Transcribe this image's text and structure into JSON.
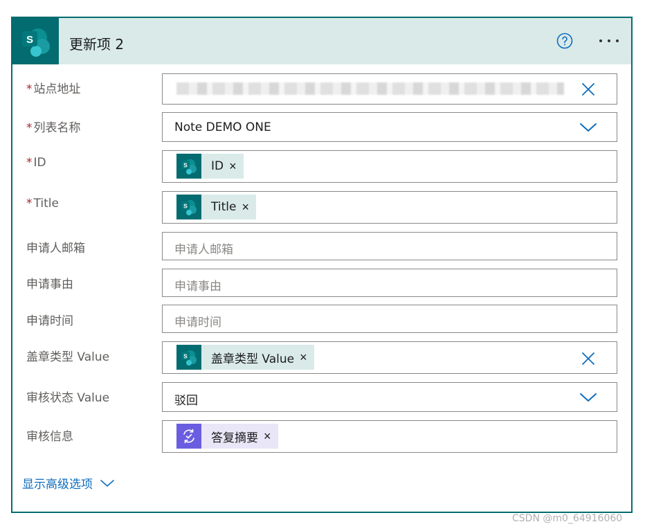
{
  "header": {
    "title": "更新项 2",
    "logo_letter": "S",
    "accent_color": "#036c70"
  },
  "fields": {
    "site": {
      "label": "站点地址",
      "required": "*"
    },
    "list": {
      "label": "列表名称",
      "required": "*",
      "value": "Note DEMO ONE"
    },
    "id": {
      "label": "ID",
      "required": "*",
      "token": "ID"
    },
    "title": {
      "label": "Title",
      "required": "*",
      "token": "Title"
    },
    "email": {
      "label": "申请人邮箱",
      "placeholder": "申请人邮箱"
    },
    "reason": {
      "label": "申请事由",
      "placeholder": "申请事由"
    },
    "time": {
      "label": "申请时间",
      "placeholder": "申请时间"
    },
    "seal": {
      "label": "盖章类型 Value",
      "token": "盖章类型 Value"
    },
    "status": {
      "label": "审核状态 Value",
      "value": "驳回"
    },
    "review": {
      "label": "审核信息",
      "token": "答复摘要"
    }
  },
  "token_remove": "×",
  "advanced": {
    "label": "显示高级选项"
  },
  "watermark": "CSDN @m0_64916060"
}
